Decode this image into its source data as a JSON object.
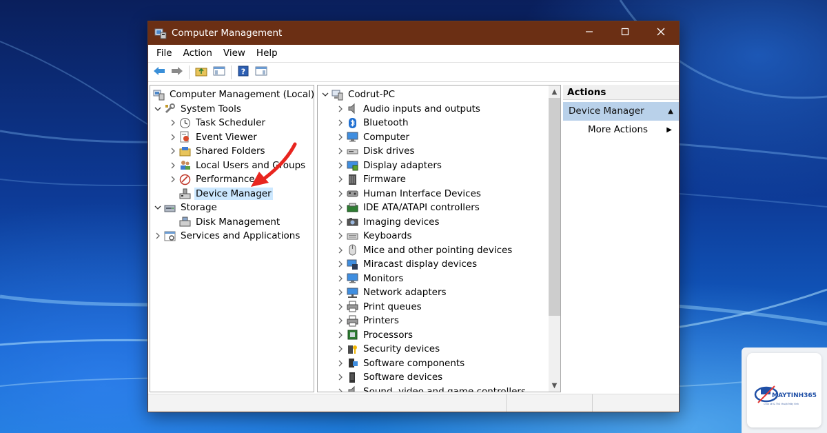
{
  "window": {
    "title": "Computer Management",
    "controls": {
      "minimize": "minimize-icon",
      "maximize": "maximize-icon",
      "close": "close-icon"
    }
  },
  "menu": [
    "File",
    "Action",
    "View",
    "Help"
  ],
  "toolbar": {
    "buttons": [
      "back-icon",
      "forward-icon",
      "up-folder-icon",
      "show-hide-tree-icon",
      "help-icon",
      "show-hide-action-pane-icon"
    ]
  },
  "left_tree": [
    {
      "label": "Computer Management (Local)",
      "icon": "computer-management-icon",
      "expander": ""
    },
    {
      "label": "System Tools",
      "icon": "system-tools-icon",
      "expander": "collapse"
    },
    {
      "label": "Task Scheduler",
      "icon": "clock-icon",
      "expander": "expand"
    },
    {
      "label": "Event Viewer",
      "icon": "event-viewer-icon",
      "expander": "expand"
    },
    {
      "label": "Shared Folders",
      "icon": "shared-folders-icon",
      "expander": "expand"
    },
    {
      "label": "Local Users and Groups",
      "icon": "users-icon",
      "expander": "expand"
    },
    {
      "label": "Performance",
      "icon": "performance-icon",
      "expander": "expand"
    },
    {
      "label": "Device Manager",
      "icon": "device-manager-icon",
      "expander": "",
      "selected": true
    },
    {
      "label": "Storage",
      "icon": "storage-icon",
      "expander": "collapse"
    },
    {
      "label": "Disk Management",
      "icon": "disk-management-icon",
      "expander": ""
    },
    {
      "label": "Services and Applications",
      "icon": "services-icon",
      "expander": "expand"
    }
  ],
  "device_tree": {
    "root": "Codrut-PC",
    "categories": [
      {
        "label": "Audio inputs and outputs",
        "icon": "speaker-icon"
      },
      {
        "label": "Bluetooth",
        "icon": "bluetooth-icon"
      },
      {
        "label": "Computer",
        "icon": "monitor-icon"
      },
      {
        "label": "Disk drives",
        "icon": "disk-drive-icon"
      },
      {
        "label": "Display adapters",
        "icon": "display-adapter-icon"
      },
      {
        "label": "Firmware",
        "icon": "firmware-icon"
      },
      {
        "label": "Human Interface Devices",
        "icon": "hid-icon"
      },
      {
        "label": "IDE ATA/ATAPI controllers",
        "icon": "ide-controller-icon"
      },
      {
        "label": "Imaging devices",
        "icon": "camera-icon"
      },
      {
        "label": "Keyboards",
        "icon": "keyboard-icon"
      },
      {
        "label": "Mice and other pointing devices",
        "icon": "mouse-icon"
      },
      {
        "label": "Miracast display devices",
        "icon": "miracast-icon"
      },
      {
        "label": "Monitors",
        "icon": "monitor-icon"
      },
      {
        "label": "Network adapters",
        "icon": "network-adapter-icon"
      },
      {
        "label": "Print queues",
        "icon": "printer-icon"
      },
      {
        "label": "Printers",
        "icon": "printer-icon"
      },
      {
        "label": "Processors",
        "icon": "processor-icon"
      },
      {
        "label": "Security devices",
        "icon": "security-device-icon"
      },
      {
        "label": "Software components",
        "icon": "software-component-icon"
      },
      {
        "label": "Software devices",
        "icon": "software-device-icon"
      },
      {
        "label": "Sound, video and game controllers",
        "icon": "sound-controller-icon"
      }
    ]
  },
  "actions": {
    "header": "Actions",
    "section": "Device Manager",
    "items": [
      "More Actions"
    ]
  },
  "logo": {
    "name": "MAYTINH365",
    "tagline": "Chia sẻ & Thủ thuật Máy tính"
  },
  "colors": {
    "titlebar": "#6b2f14",
    "selection": "#cce8ff",
    "actions_section": "#b9d1ea",
    "annotation_arrow": "#e8251f"
  }
}
